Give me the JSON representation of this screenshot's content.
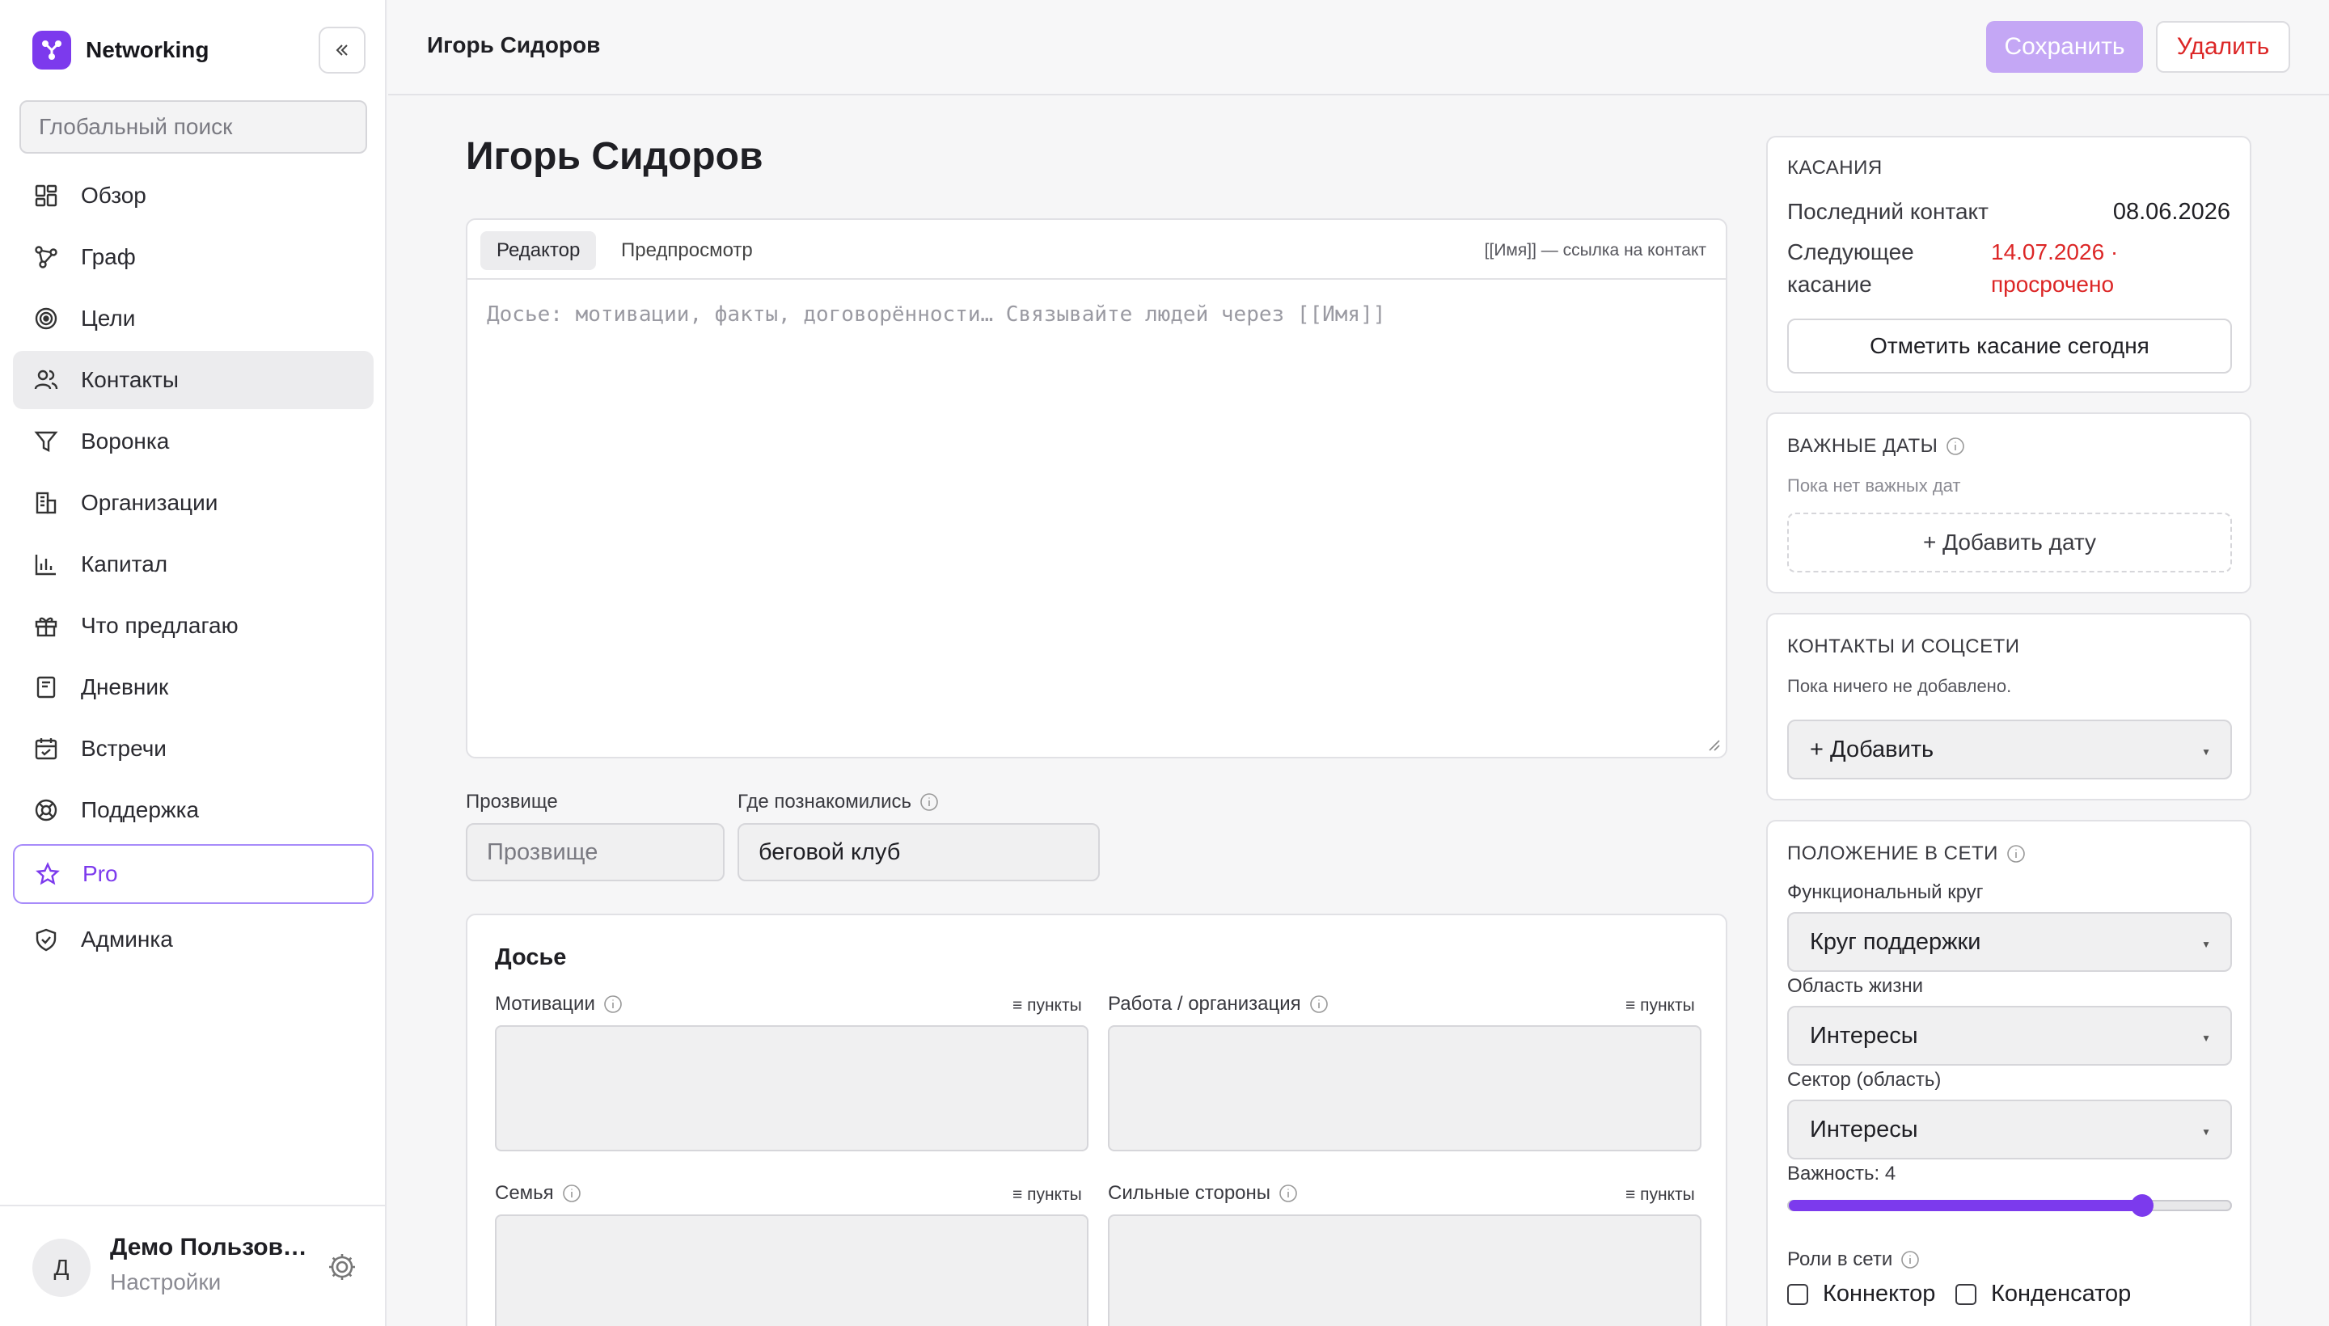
{
  "app": {
    "name": "Networking"
  },
  "sidebar": {
    "search_placeholder": "Глобальный поиск",
    "items": [
      {
        "label": "Обзор",
        "icon": "dashboard-icon"
      },
      {
        "label": "Граф",
        "icon": "graph-icon"
      },
      {
        "label": "Цели",
        "icon": "target-icon"
      },
      {
        "label": "Контакты",
        "icon": "users-icon",
        "active": true
      },
      {
        "label": "Воронка",
        "icon": "funnel-icon"
      },
      {
        "label": "Организации",
        "icon": "building-icon"
      },
      {
        "label": "Капитал",
        "icon": "bar-chart-icon"
      },
      {
        "label": "Что предлагаю",
        "icon": "gift-icon"
      },
      {
        "label": "Дневник",
        "icon": "journal-icon"
      },
      {
        "label": "Встречи",
        "icon": "calendar-icon"
      },
      {
        "label": "Поддержка",
        "icon": "lifebuoy-icon"
      },
      {
        "label": "Pro",
        "icon": "star-icon"
      },
      {
        "label": "Админка",
        "icon": "shield-icon"
      }
    ],
    "user": {
      "initial": "Д",
      "name": "Демо Пользователь",
      "settings": "Настройки"
    }
  },
  "topbar": {
    "title": "Игорь Сидоров",
    "save": "Сохранить",
    "delete": "Удалить"
  },
  "main": {
    "title": "Игорь Сидоров",
    "editor": {
      "tab_editor": "Редактор",
      "tab_preview": "Предпросмотр",
      "hint": "[[Имя]] — ссылка на контакт",
      "placeholder": "Досье: мотивации, факты, договорённости… Связывайте людей через [[Имя]]"
    },
    "nickname": {
      "label": "Прозвище",
      "placeholder": "Прозвище"
    },
    "met_where": {
      "label": "Где познакомились",
      "value": "беговой клуб"
    },
    "dossier": {
      "title": "Досье",
      "list_toggle": "≡ пункты",
      "fields": [
        {
          "label": "Мотивации"
        },
        {
          "label": "Работа / организация"
        },
        {
          "label": "Семья"
        },
        {
          "label": "Сильные стороны"
        }
      ]
    }
  },
  "right": {
    "touches": {
      "title": "КАСАНИЯ",
      "last_label": "Последний контакт",
      "last_value": "08.06.2026",
      "next_label_1": "Следующее",
      "next_label_2": "касание",
      "next_value_1": "14.07.2026 ·",
      "next_value_2": "просрочено",
      "mark_button": "Отметить касание сегодня"
    },
    "dates": {
      "title": "ВАЖНЫЕ ДАТЫ",
      "empty": "Пока нет важных дат",
      "add": "+ Добавить дату"
    },
    "socials": {
      "title": "КОНТАКТЫ И СОЦСЕТИ",
      "empty": "Пока ничего не добавлено.",
      "add": "+ Добавить"
    },
    "network": {
      "title": "ПОЛОЖЕНИЕ В СЕТИ",
      "circle_label": "Функциональный круг",
      "circle_value": "Круг поддержки",
      "area_label": "Область жизни",
      "area_value": "Интересы",
      "sector_label": "Сектор (область)",
      "sector_value": "Интересы",
      "importance_label": "Важность: 4",
      "importance_fraction": 0.8,
      "roles_label": "Роли в сети",
      "roles": [
        "Коннектор",
        "Конденсатор"
      ]
    }
  },
  "colors": {
    "accent": "#7c3aed",
    "danger": "#dc2626",
    "save_disabled": "#c4a7f5"
  }
}
